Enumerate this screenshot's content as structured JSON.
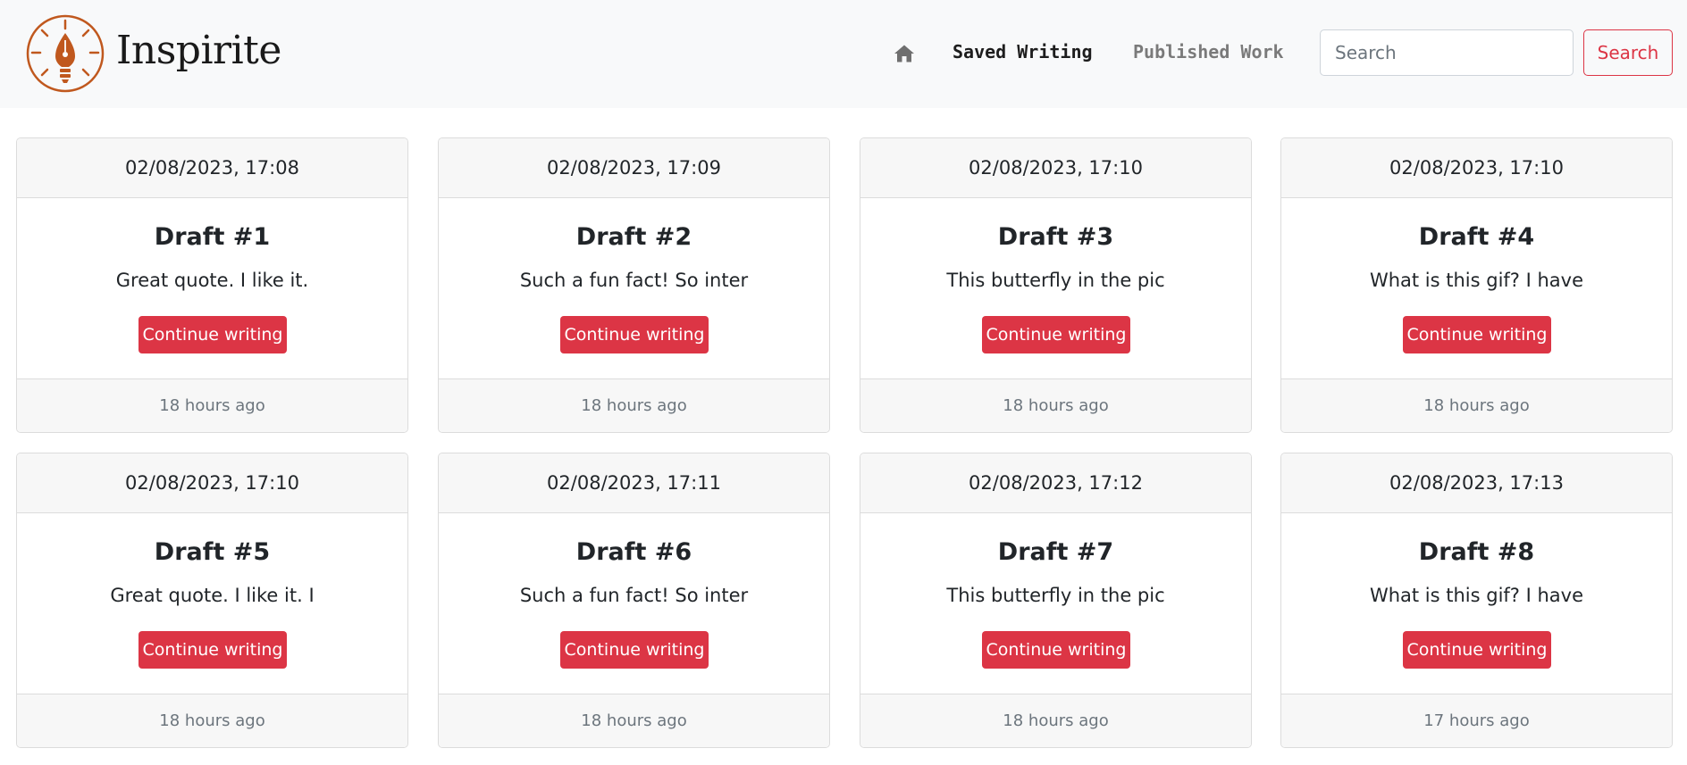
{
  "brand": {
    "name": "Inspirite",
    "logo_icon": "lightbulb-pen-icon",
    "logo_color": "#c0581e"
  },
  "nav": {
    "home_icon": "home-icon",
    "saved_label": "Saved Writing",
    "published_label": "Published Work"
  },
  "search": {
    "placeholder": "Search",
    "button_label": "Search"
  },
  "accent_color": "#dc3545",
  "cards": [
    {
      "date": "02/08/2023, 17:08",
      "title": "Draft #1",
      "excerpt": "Great quote. I like it.",
      "button": "Continue writing",
      "ago": "18 hours ago"
    },
    {
      "date": "02/08/2023, 17:09",
      "title": "Draft #2",
      "excerpt": "Such a fun fact! So inter",
      "button": "Continue writing",
      "ago": "18 hours ago"
    },
    {
      "date": "02/08/2023, 17:10",
      "title": "Draft #3",
      "excerpt": "This butterfly in the pic",
      "button": "Continue writing",
      "ago": "18 hours ago"
    },
    {
      "date": "02/08/2023, 17:10",
      "title": "Draft #4",
      "excerpt": "What is this gif? I have",
      "button": "Continue writing",
      "ago": "18 hours ago"
    },
    {
      "date": "02/08/2023, 17:10",
      "title": "Draft #5",
      "excerpt": "Great quote. I like it. I",
      "button": "Continue writing",
      "ago": "18 hours ago"
    },
    {
      "date": "02/08/2023, 17:11",
      "title": "Draft #6",
      "excerpt": "Such a fun fact! So inter",
      "button": "Continue writing",
      "ago": "18 hours ago"
    },
    {
      "date": "02/08/2023, 17:12",
      "title": "Draft #7",
      "excerpt": "This butterfly in the pic",
      "button": "Continue writing",
      "ago": "18 hours ago"
    },
    {
      "date": "02/08/2023, 17:13",
      "title": "Draft #8",
      "excerpt": "What is this gif? I have",
      "button": "Continue writing",
      "ago": "17 hours ago"
    }
  ]
}
